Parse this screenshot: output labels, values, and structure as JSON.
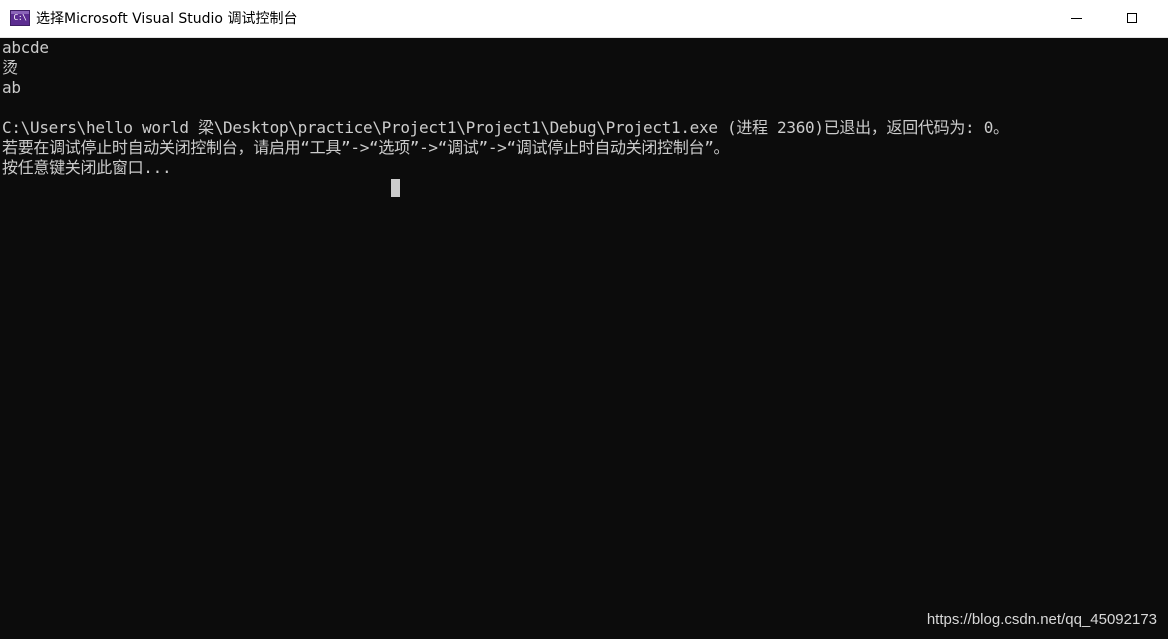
{
  "window": {
    "title": "选择Microsoft Visual Studio 调试控制台",
    "icon": {
      "name": "visual-studio-console-icon",
      "glyph": "C:\\",
      "color": "#5c2d91"
    },
    "controls": {
      "minimize": "minimize-icon",
      "maximize": "maximize-icon"
    }
  },
  "console": {
    "background": "#0c0c0c",
    "foreground": "#cccccc",
    "lines": [
      "abcde",
      "烫",
      "ab",
      "",
      "C:\\Users\\hello world 梁\\Desktop\\practice\\Project1\\Project1\\Debug\\Project1.exe (进程 2360)已退出，返回代码为: 0。",
      "若要在调试停止时自动关闭控制台，请启用“工具”->“选项”->“调试”->“调试停止时自动关闭控制台”。",
      "按任意键关闭此窗口..."
    ]
  },
  "watermark": "https://blog.csdn.net/qq_45092173"
}
